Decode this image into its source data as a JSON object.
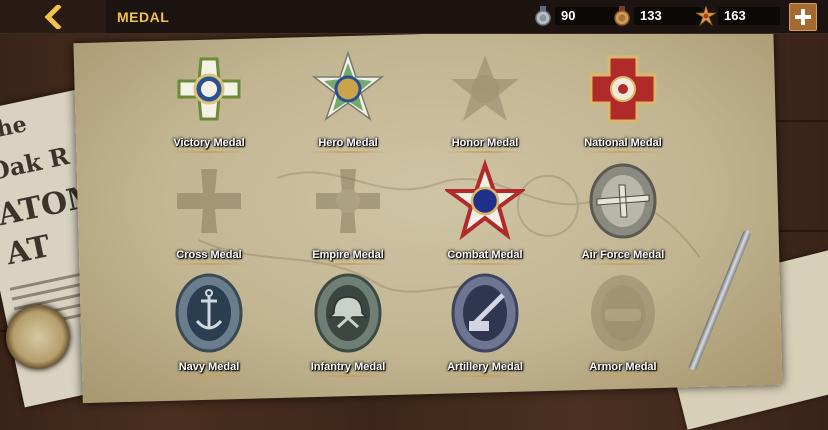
{
  "header": {
    "title": "MEDAL"
  },
  "resources": [
    {
      "name": "silver-medal",
      "value": "90"
    },
    {
      "name": "bronze-medal",
      "value": "133"
    },
    {
      "name": "star-badge",
      "value": "163"
    }
  ],
  "medals": [
    {
      "label": "Victory Medal",
      "unlocked": true
    },
    {
      "label": "Hero Medal",
      "unlocked": true
    },
    {
      "label": "Honor Medal",
      "unlocked": false
    },
    {
      "label": "National Medal",
      "unlocked": true
    },
    {
      "label": "Cross Medal",
      "unlocked": false
    },
    {
      "label": "Empire Medal",
      "unlocked": false
    },
    {
      "label": "Combat Medal",
      "unlocked": true
    },
    {
      "label": "Air Force Medal",
      "unlocked": true
    },
    {
      "label": "Navy Medal",
      "unlocked": true
    },
    {
      "label": "Infantry Medal",
      "unlocked": true
    },
    {
      "label": "Artillery Medal",
      "unlocked": true
    },
    {
      "label": "Armor Medal",
      "unlocked": false
    }
  ],
  "background": {
    "newspaper_text": [
      "The",
      "Oak R",
      "ATOM",
      "AT"
    ]
  }
}
